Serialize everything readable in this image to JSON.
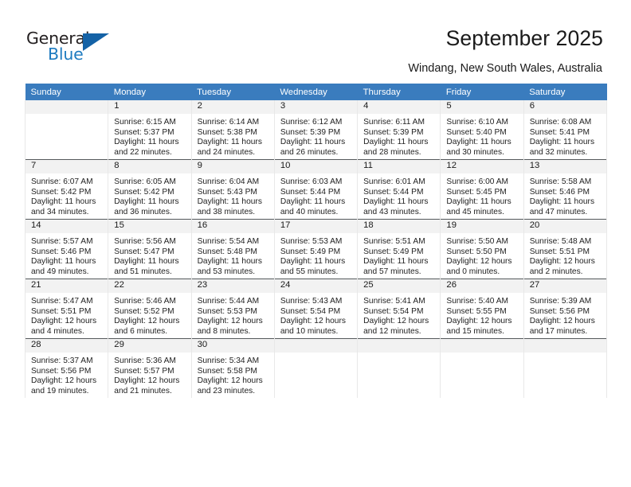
{
  "brand": {
    "name_part1": "General",
    "name_part2": "Blue",
    "accent_color": "#1462a6",
    "text_color": "#231f20"
  },
  "header": {
    "title": "September 2025",
    "subtitle": "Windang, New South Wales, Australia"
  },
  "calendar": {
    "header_bg": "#3a7cbe",
    "daynum_bg": "#f2f2f2",
    "weekday_headers": [
      "Sunday",
      "Monday",
      "Tuesday",
      "Wednesday",
      "Thursday",
      "Friday",
      "Saturday"
    ],
    "labels": {
      "sunrise": "Sunrise:",
      "sunset": "Sunset:",
      "daylight": "Daylight:"
    },
    "weeks": [
      [
        {
          "day": "",
          "empty": true
        },
        {
          "day": "1",
          "sunrise": "Sunrise: 6:15 AM",
          "sunset": "Sunset: 5:37 PM",
          "daylight_line1": "Daylight: 11 hours",
          "daylight_line2": "and 22 minutes."
        },
        {
          "day": "2",
          "sunrise": "Sunrise: 6:14 AM",
          "sunset": "Sunset: 5:38 PM",
          "daylight_line1": "Daylight: 11 hours",
          "daylight_line2": "and 24 minutes."
        },
        {
          "day": "3",
          "sunrise": "Sunrise: 6:12 AM",
          "sunset": "Sunset: 5:39 PM",
          "daylight_line1": "Daylight: 11 hours",
          "daylight_line2": "and 26 minutes."
        },
        {
          "day": "4",
          "sunrise": "Sunrise: 6:11 AM",
          "sunset": "Sunset: 5:39 PM",
          "daylight_line1": "Daylight: 11 hours",
          "daylight_line2": "and 28 minutes."
        },
        {
          "day": "5",
          "sunrise": "Sunrise: 6:10 AM",
          "sunset": "Sunset: 5:40 PM",
          "daylight_line1": "Daylight: 11 hours",
          "daylight_line2": "and 30 minutes."
        },
        {
          "day": "6",
          "sunrise": "Sunrise: 6:08 AM",
          "sunset": "Sunset: 5:41 PM",
          "daylight_line1": "Daylight: 11 hours",
          "daylight_line2": "and 32 minutes."
        }
      ],
      [
        {
          "day": "7",
          "sunrise": "Sunrise: 6:07 AM",
          "sunset": "Sunset: 5:42 PM",
          "daylight_line1": "Daylight: 11 hours",
          "daylight_line2": "and 34 minutes."
        },
        {
          "day": "8",
          "sunrise": "Sunrise: 6:05 AM",
          "sunset": "Sunset: 5:42 PM",
          "daylight_line1": "Daylight: 11 hours",
          "daylight_line2": "and 36 minutes."
        },
        {
          "day": "9",
          "sunrise": "Sunrise: 6:04 AM",
          "sunset": "Sunset: 5:43 PM",
          "daylight_line1": "Daylight: 11 hours",
          "daylight_line2": "and 38 minutes."
        },
        {
          "day": "10",
          "sunrise": "Sunrise: 6:03 AM",
          "sunset": "Sunset: 5:44 PM",
          "daylight_line1": "Daylight: 11 hours",
          "daylight_line2": "and 40 minutes."
        },
        {
          "day": "11",
          "sunrise": "Sunrise: 6:01 AM",
          "sunset": "Sunset: 5:44 PM",
          "daylight_line1": "Daylight: 11 hours",
          "daylight_line2": "and 43 minutes."
        },
        {
          "day": "12",
          "sunrise": "Sunrise: 6:00 AM",
          "sunset": "Sunset: 5:45 PM",
          "daylight_line1": "Daylight: 11 hours",
          "daylight_line2": "and 45 minutes."
        },
        {
          "day": "13",
          "sunrise": "Sunrise: 5:58 AM",
          "sunset": "Sunset: 5:46 PM",
          "daylight_line1": "Daylight: 11 hours",
          "daylight_line2": "and 47 minutes."
        }
      ],
      [
        {
          "day": "14",
          "sunrise": "Sunrise: 5:57 AM",
          "sunset": "Sunset: 5:46 PM",
          "daylight_line1": "Daylight: 11 hours",
          "daylight_line2": "and 49 minutes."
        },
        {
          "day": "15",
          "sunrise": "Sunrise: 5:56 AM",
          "sunset": "Sunset: 5:47 PM",
          "daylight_line1": "Daylight: 11 hours",
          "daylight_line2": "and 51 minutes."
        },
        {
          "day": "16",
          "sunrise": "Sunrise: 5:54 AM",
          "sunset": "Sunset: 5:48 PM",
          "daylight_line1": "Daylight: 11 hours",
          "daylight_line2": "and 53 minutes."
        },
        {
          "day": "17",
          "sunrise": "Sunrise: 5:53 AM",
          "sunset": "Sunset: 5:49 PM",
          "daylight_line1": "Daylight: 11 hours",
          "daylight_line2": "and 55 minutes."
        },
        {
          "day": "18",
          "sunrise": "Sunrise: 5:51 AM",
          "sunset": "Sunset: 5:49 PM",
          "daylight_line1": "Daylight: 11 hours",
          "daylight_line2": "and 57 minutes."
        },
        {
          "day": "19",
          "sunrise": "Sunrise: 5:50 AM",
          "sunset": "Sunset: 5:50 PM",
          "daylight_line1": "Daylight: 12 hours",
          "daylight_line2": "and 0 minutes."
        },
        {
          "day": "20",
          "sunrise": "Sunrise: 5:48 AM",
          "sunset": "Sunset: 5:51 PM",
          "daylight_line1": "Daylight: 12 hours",
          "daylight_line2": "and 2 minutes."
        }
      ],
      [
        {
          "day": "21",
          "sunrise": "Sunrise: 5:47 AM",
          "sunset": "Sunset: 5:51 PM",
          "daylight_line1": "Daylight: 12 hours",
          "daylight_line2": "and 4 minutes."
        },
        {
          "day": "22",
          "sunrise": "Sunrise: 5:46 AM",
          "sunset": "Sunset: 5:52 PM",
          "daylight_line1": "Daylight: 12 hours",
          "daylight_line2": "and 6 minutes."
        },
        {
          "day": "23",
          "sunrise": "Sunrise: 5:44 AM",
          "sunset": "Sunset: 5:53 PM",
          "daylight_line1": "Daylight: 12 hours",
          "daylight_line2": "and 8 minutes."
        },
        {
          "day": "24",
          "sunrise": "Sunrise: 5:43 AM",
          "sunset": "Sunset: 5:54 PM",
          "daylight_line1": "Daylight: 12 hours",
          "daylight_line2": "and 10 minutes."
        },
        {
          "day": "25",
          "sunrise": "Sunrise: 5:41 AM",
          "sunset": "Sunset: 5:54 PM",
          "daylight_line1": "Daylight: 12 hours",
          "daylight_line2": "and 12 minutes."
        },
        {
          "day": "26",
          "sunrise": "Sunrise: 5:40 AM",
          "sunset": "Sunset: 5:55 PM",
          "daylight_line1": "Daylight: 12 hours",
          "daylight_line2": "and 15 minutes."
        },
        {
          "day": "27",
          "sunrise": "Sunrise: 5:39 AM",
          "sunset": "Sunset: 5:56 PM",
          "daylight_line1": "Daylight: 12 hours",
          "daylight_line2": "and 17 minutes."
        }
      ],
      [
        {
          "day": "28",
          "sunrise": "Sunrise: 5:37 AM",
          "sunset": "Sunset: 5:56 PM",
          "daylight_line1": "Daylight: 12 hours",
          "daylight_line2": "and 19 minutes."
        },
        {
          "day": "29",
          "sunrise": "Sunrise: 5:36 AM",
          "sunset": "Sunset: 5:57 PM",
          "daylight_line1": "Daylight: 12 hours",
          "daylight_line2": "and 21 minutes."
        },
        {
          "day": "30",
          "sunrise": "Sunrise: 5:34 AM",
          "sunset": "Sunset: 5:58 PM",
          "daylight_line1": "Daylight: 12 hours",
          "daylight_line2": "and 23 minutes."
        },
        {
          "day": "",
          "empty": true
        },
        {
          "day": "",
          "empty": true
        },
        {
          "day": "",
          "empty": true
        },
        {
          "day": "",
          "empty": true
        }
      ]
    ]
  }
}
